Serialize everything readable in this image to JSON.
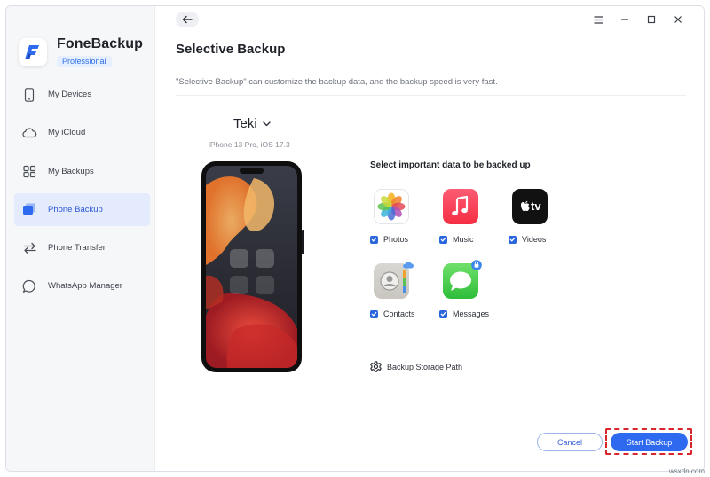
{
  "app": {
    "name": "FoneBackup",
    "edition": "Professional"
  },
  "sidebar": {
    "items": [
      {
        "label": "My Devices",
        "icon": "phone-outline-icon",
        "active": false
      },
      {
        "label": "My iCloud",
        "icon": "cloud-icon",
        "active": false
      },
      {
        "label": "My Backups",
        "icon": "backups-icon",
        "active": false
      },
      {
        "label": "Phone Backup",
        "icon": "phone-backup-icon",
        "active": true
      },
      {
        "label": "Phone Transfer",
        "icon": "transfer-arrows-icon",
        "active": false
      },
      {
        "label": "WhatsApp Manager",
        "icon": "chat-bubble-icon",
        "active": false
      }
    ]
  },
  "main": {
    "title": "Selective Backup",
    "description": "\"Selective Backup\" can customize the backup data, and the backup speed is very fast.",
    "device": {
      "name": "Teki",
      "model": "iPhone 13 Pro, iOS 17.3"
    },
    "section_title": "Select important data to be backed up",
    "data_types": [
      {
        "label": "Photos",
        "checked": true,
        "icon": "photos-app-icon"
      },
      {
        "label": "Music",
        "checked": true,
        "icon": "music-app-icon"
      },
      {
        "label": "Videos",
        "checked": true,
        "icon": "apple-tv-app-icon"
      },
      {
        "label": "Contacts",
        "checked": true,
        "icon": "contacts-app-icon"
      },
      {
        "label": "Messages",
        "checked": true,
        "icon": "messages-app-icon"
      }
    ],
    "storage_path_label": "Backup Storage Path",
    "cancel_label": "Cancel",
    "start_label": "Start Backup",
    "appletv_label": "tv"
  },
  "watermark": "wsxdn.com",
  "colors": {
    "accent": "#2d6af0",
    "active_nav_bg": "#e4ebfd",
    "highlight_dash": "#d8262c"
  }
}
